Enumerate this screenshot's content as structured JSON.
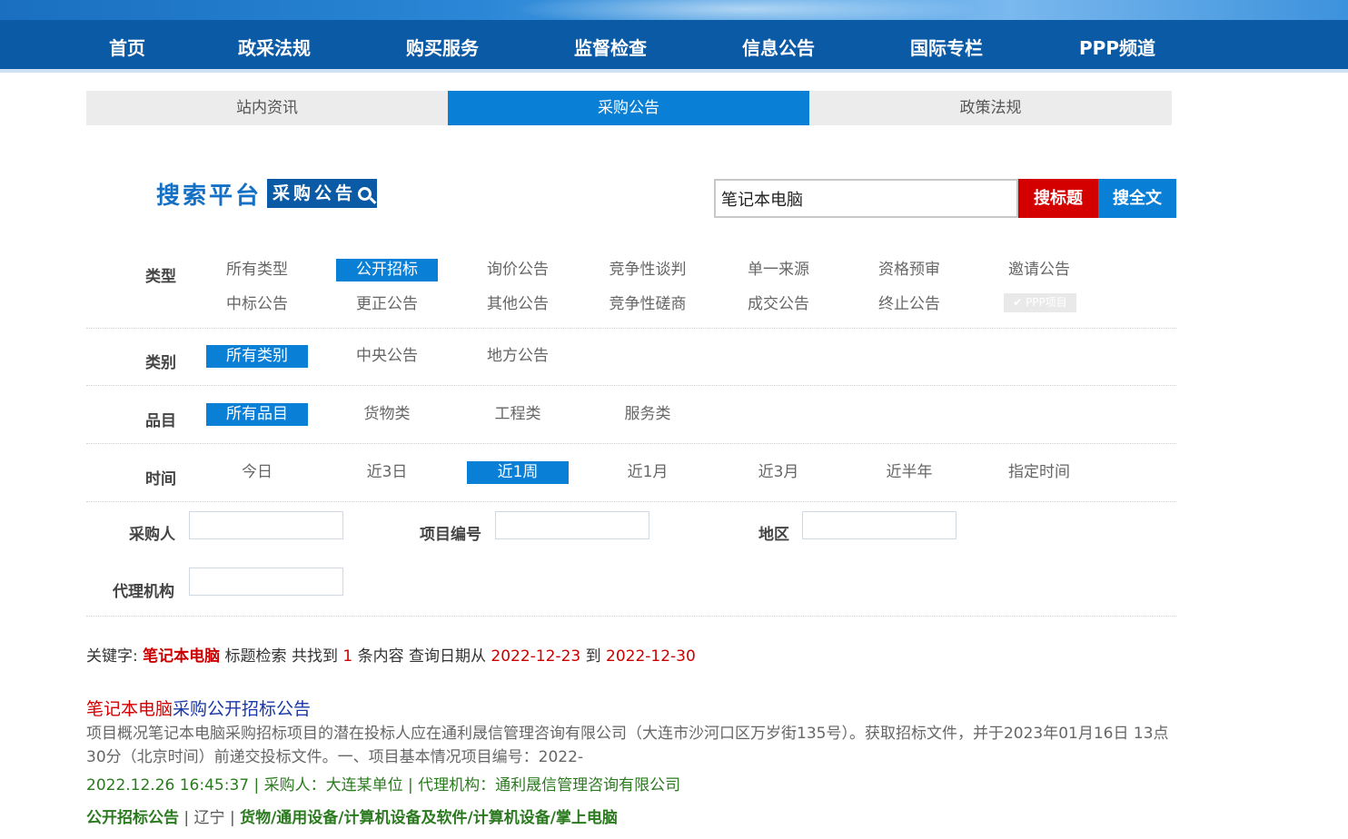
{
  "nav": {
    "items": [
      "首页",
      "政采法规",
      "购买服务",
      "监督检查",
      "信息公告",
      "国际专栏",
      "PPP频道"
    ]
  },
  "tabs": [
    {
      "label": "站内资讯",
      "active": false
    },
    {
      "label": "采购公告",
      "active": true
    },
    {
      "label": "政策法规",
      "active": false
    }
  ],
  "brand": {
    "title": "搜索平台",
    "subtitle": "采购公告"
  },
  "search": {
    "value": "笔记本电脑",
    "btn_title": "搜标题",
    "btn_full": "搜全文"
  },
  "filters": {
    "type": {
      "label": "类型",
      "options": [
        "所有类型",
        "公开招标",
        "询价公告",
        "竞争性谈判",
        "单一来源",
        "资格预审",
        "邀请公告",
        "中标公告",
        "更正公告",
        "其他公告",
        "竞争性磋商",
        "成交公告",
        "终止公告",
        "✔ PPP项目"
      ],
      "selected": "公开招标"
    },
    "category": {
      "label": "类别",
      "options": [
        "所有类别",
        "中央公告",
        "地方公告"
      ],
      "selected": "所有类别"
    },
    "item": {
      "label": "品目",
      "options": [
        "所有品目",
        "货物类",
        "工程类",
        "服务类"
      ],
      "selected": "所有品目"
    },
    "time": {
      "label": "时间",
      "options": [
        "今日",
        "近3日",
        "近1周",
        "近1月",
        "近3月",
        "近半年",
        "指定时间"
      ],
      "selected": "近1周"
    },
    "fields": {
      "purchaser": "采购人",
      "project_no": "项目编号",
      "region": "地区",
      "agency": "代理机构"
    }
  },
  "summary": {
    "prefix": "关键字:",
    "keyword": "笔记本电脑",
    "mode": "标题检索 共找到",
    "count": "1",
    "mid": "条内容 查询日期从",
    "from": "2022-12-23",
    "to_word": "到",
    "to": "2022-12-30"
  },
  "result": {
    "title_hl": "笔记本电脑",
    "title_rest": "采购公开招标公告",
    "desc": "项目概况笔记本电脑采购招标项目的潜在投标人应在通利晟信管理咨询有限公司（大连市沙河口区万岁街135号）。获取招标文件，并于2023年01月16日 13点30分（北京时间）前递交投标文件。一、项目基本情况项目编号：2022-",
    "meta": "2022.12.26 16:45:37 | 采购人：大连某单位 | 代理机构：通利晟信管理咨询有限公司",
    "tag_type": "公开招标公告",
    "tag_region": "辽宁",
    "tag_category": "货物/通用设备/计算机设备及软件/计算机设备/掌上电脑"
  }
}
